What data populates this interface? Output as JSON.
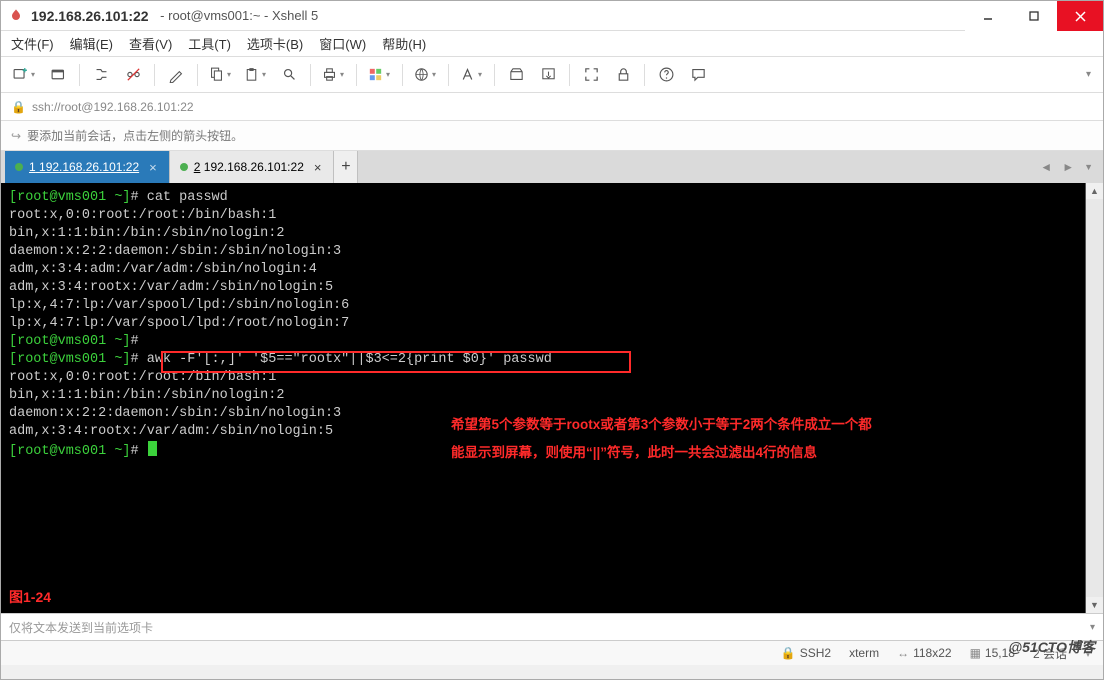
{
  "window": {
    "address_title": "192.168.26.101:22",
    "title_suffix": "root@vms001:~ - Xshell 5"
  },
  "menus": {
    "file": "文件(F)",
    "edit": "编辑(E)",
    "view": "查看(V)",
    "tools": "工具(T)",
    "tab": "选项卡(B)",
    "window": "窗口(W)",
    "help": "帮助(H)"
  },
  "addressbar": {
    "url": "ssh://root@192.168.26.101:22"
  },
  "infostrip": {
    "hint": "要添加当前会话，点击左侧的箭头按钮。"
  },
  "tabs": [
    {
      "index": "1",
      "label": "192.168.26.101:22",
      "active": true
    },
    {
      "index": "2",
      "label": "192.168.26.101:22",
      "active": false
    }
  ],
  "terminal": {
    "lines": [
      "[root@vms001 ~]# cat passwd",
      "root:x,0:0:root:/root:/bin/bash:1",
      "bin,x:1:1:bin:/bin:/sbin/nologin:2",
      "daemon:x:2:2:daemon:/sbin:/sbin/nologin:3",
      "adm,x:3:4:adm:/var/adm:/sbin/nologin:4",
      "adm,x:3:4:rootx:/var/adm:/sbin/nologin:5",
      "lp:x,4:7:lp:/var/spool/lpd:/sbin/nologin:6",
      "lp:x,4:7:lp:/var/spool/lpd:/root/nologin:7",
      "[root@vms001 ~]#",
      "[root@vms001 ~]# awk -F'[:,]' '$5==\"rootx\"||$3<=2{print $0}' passwd",
      "root:x,0:0:root:/root:/bin/bash:1",
      "bin,x:1:1:bin:/bin:/sbin/nologin:2",
      "daemon:x:2:2:daemon:/sbin:/sbin/nologin:3",
      "adm,x:3:4:rootx:/var/adm:/sbin/nologin:5",
      "[root@vms001 ~]# "
    ],
    "annotation_line1": "希望第5个参数等于rootx或者第3个参数小于等于2两个条件成立一个都",
    "annotation_line2": "能显示到屏幕，则使用“||”符号，此时一共会过滤出4行的信息",
    "figure_label": "图1-24"
  },
  "footer": {
    "placeholder": "仅将文本发送到当前选项卡"
  },
  "status": {
    "proto": "SSH2",
    "term": "xterm",
    "size": "118x22",
    "cursor": "15,18",
    "sessions": "2 会话"
  },
  "watermark": "@51CTO博客"
}
